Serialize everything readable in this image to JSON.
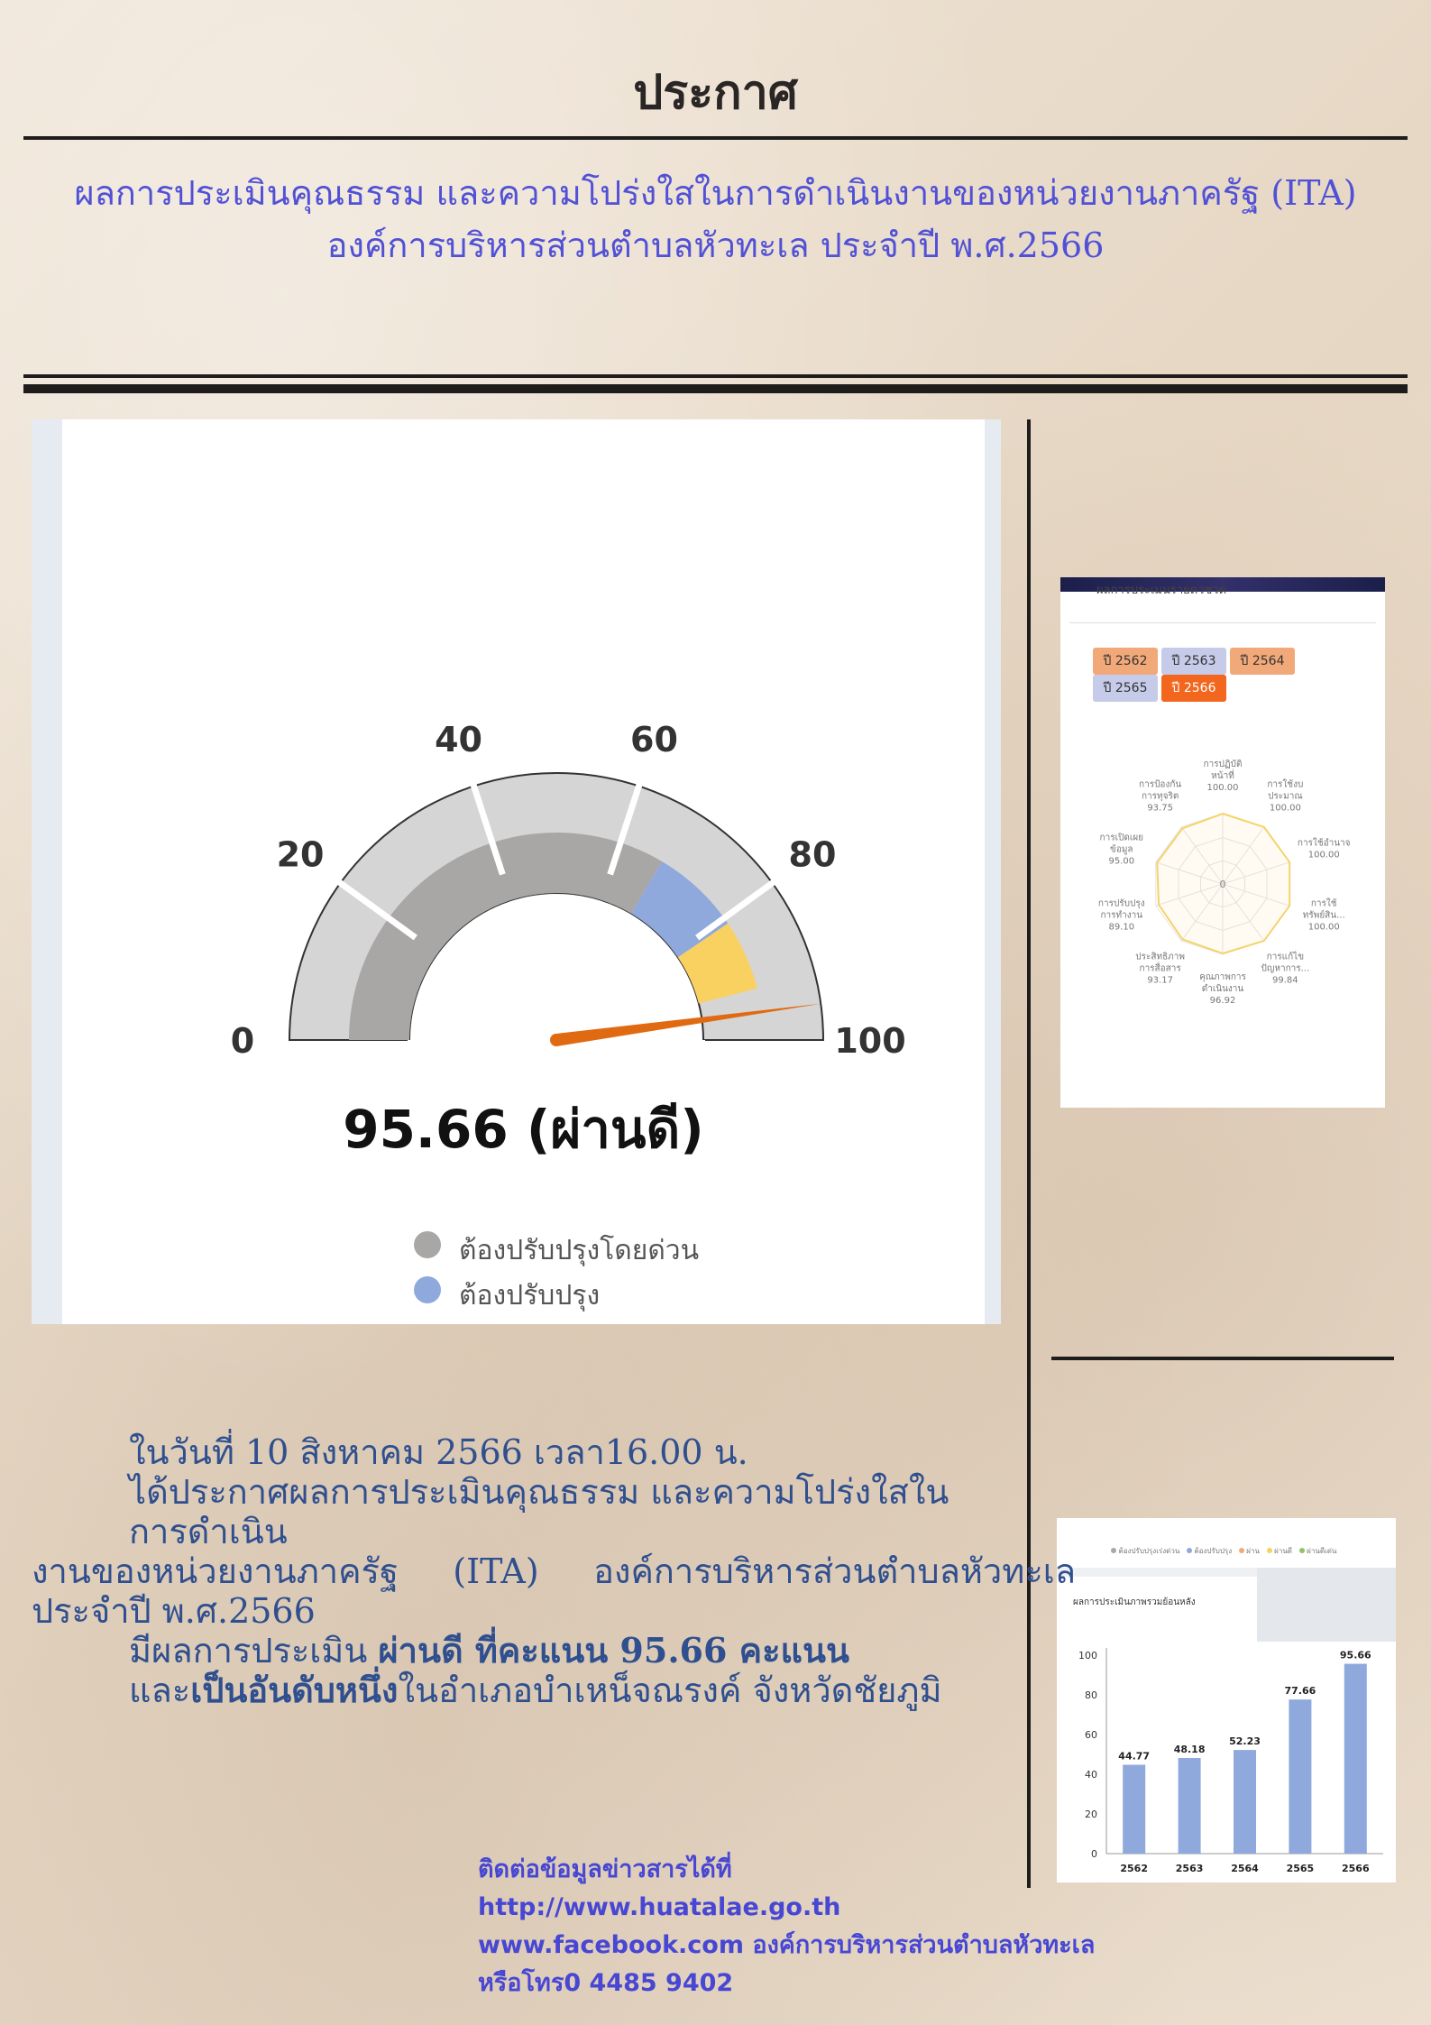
{
  "header": {
    "title": "ประกาศ",
    "subtitle_line1": "ผลการประเมินคุณธรรม และความโปร่งใสในการดำเนินงานของหน่วยงานภาครัฐ (ITA)",
    "subtitle_line2": "องค์การบริหารส่วนตำบลหัวทะเล  ประจำปี พ.ศ.2566"
  },
  "gauge": {
    "score": 95.66,
    "score_text": "95.66 (ผ่านดี)",
    "ticks": [
      "0",
      "20",
      "40",
      "60",
      "80",
      "100"
    ],
    "bands": [
      {
        "from": 0,
        "to": 67,
        "color": "#a9a6a6"
      },
      {
        "from": 67,
        "to": 81,
        "color": "#8fa9dc"
      },
      {
        "from": 81,
        "to": 92,
        "color": "#f9d160"
      }
    ],
    "legend": [
      {
        "label": "ต้องปรับปรุงโดยด่วน",
        "color": "#a9a6a6"
      },
      {
        "label": "ต้องปรับปรุง",
        "color": "#8fa9dc"
      }
    ]
  },
  "radar": {
    "header_text": "ผลการประเมินรายตัวชี้วัด",
    "year_buttons": [
      {
        "label": "ปี 2562",
        "color": "#f2a97a"
      },
      {
        "label": "ปี 2563",
        "color": "#c5cbe8"
      },
      {
        "label": "ปี 2564",
        "color": "#f2a97a"
      },
      {
        "label": "ปี 2565",
        "color": "#c5cbe8"
      },
      {
        "label": "ปี 2566",
        "color": "#f2661d"
      }
    ],
    "center_label": "0",
    "axes": [
      {
        "label1": "การปฏิบัติ",
        "label2": "หน้าที่",
        "value": "100.00"
      },
      {
        "label1": "การใช้งบ",
        "label2": "ประมาณ",
        "value": "100.00"
      },
      {
        "label1": "การใช้อำนาจ",
        "label2": "",
        "value": "100.00"
      },
      {
        "label1": "การใช้",
        "label2": "ทรัพย์สิน...",
        "value": "100.00"
      },
      {
        "label1": "การแก้ไข",
        "label2": "ปัญหาการ...",
        "value": "99.84"
      },
      {
        "label1": "คุณภาพการ",
        "label2": "ดำเนินงาน",
        "value": "96.92"
      },
      {
        "label1": "ประสิทธิภาพ",
        "label2": "การสื่อสาร",
        "value": "93.17"
      },
      {
        "label1": "การปรับปรุง",
        "label2": "การทำงาน",
        "value": "89.10"
      },
      {
        "label1": "การเปิดเผย",
        "label2": "ข้อมูล",
        "value": "95.00"
      },
      {
        "label1": "การป้องกัน",
        "label2": "การทุจริต",
        "value": "93.75"
      }
    ]
  },
  "bar_chart": {
    "header_text": "ผลการประเมินภาพรวมย้อนหลัง",
    "legend": [
      {
        "label": "ต้องปรับปรุงเร่งด่วน",
        "color": "#a9a6a6"
      },
      {
        "label": "ต้องปรับปรุง",
        "color": "#8fa9dc"
      },
      {
        "label": "ผ่าน",
        "color": "#f2a97a"
      },
      {
        "label": "ผ่านดี",
        "color": "#f9d160"
      },
      {
        "label": "ผ่านดีเด่น",
        "color": "#8fc46a"
      }
    ]
  },
  "chart_data": {
    "type": "bar",
    "title": "ผลการประเมินภาพรวมย้อนหลัง",
    "categories": [
      "2562",
      "2563",
      "2564",
      "2565",
      "2566"
    ],
    "values": [
      44.77,
      48.18,
      52.23,
      77.66,
      95.66
    ],
    "value_labels": [
      "44.77",
      "48.18",
      "52.23",
      "77.66",
      "95.66"
    ],
    "yticks": [
      "0",
      "20",
      "40",
      "60",
      "80",
      "100"
    ],
    "ylim": [
      0,
      100
    ],
    "color": "#8fa9dc",
    "grid": false
  },
  "body": {
    "line1": "ในวันที่ 10 สิงหาคม 2566 เวลา16.00 น.",
    "line2": "ได้ประกาศผลการประเมินคุณธรรม และความโปร่งใสในการดำเนิน",
    "line3": "งานของหน่วยงานภาครัฐ     (ITA)     องค์การบริหารส่วนตำบลหัวทะเล",
    "line4": "ประจำปี พ.ศ.2566",
    "line5_a": "มีผลการประเมิน ",
    "line5_b": "ผ่านดี  ที่คะแนน  95.66 คะแนน",
    "line6_a": "และ",
    "line6_b": "เป็นอันดับหนึ่ง",
    "line6_c": "ในอำเภอบำเหน็จณรงค์  จังหวัดชัยภูมิ"
  },
  "contact": {
    "line1": "ติดต่อข้อมูลข่าวสารได้ที่",
    "line2": "http://www.huatalae.go.th",
    "line3": "www.facebook.com องค์การบริหารส่วนตำบลหัวทะเล",
    "line4": "หรือโทร0 4485 9402"
  }
}
